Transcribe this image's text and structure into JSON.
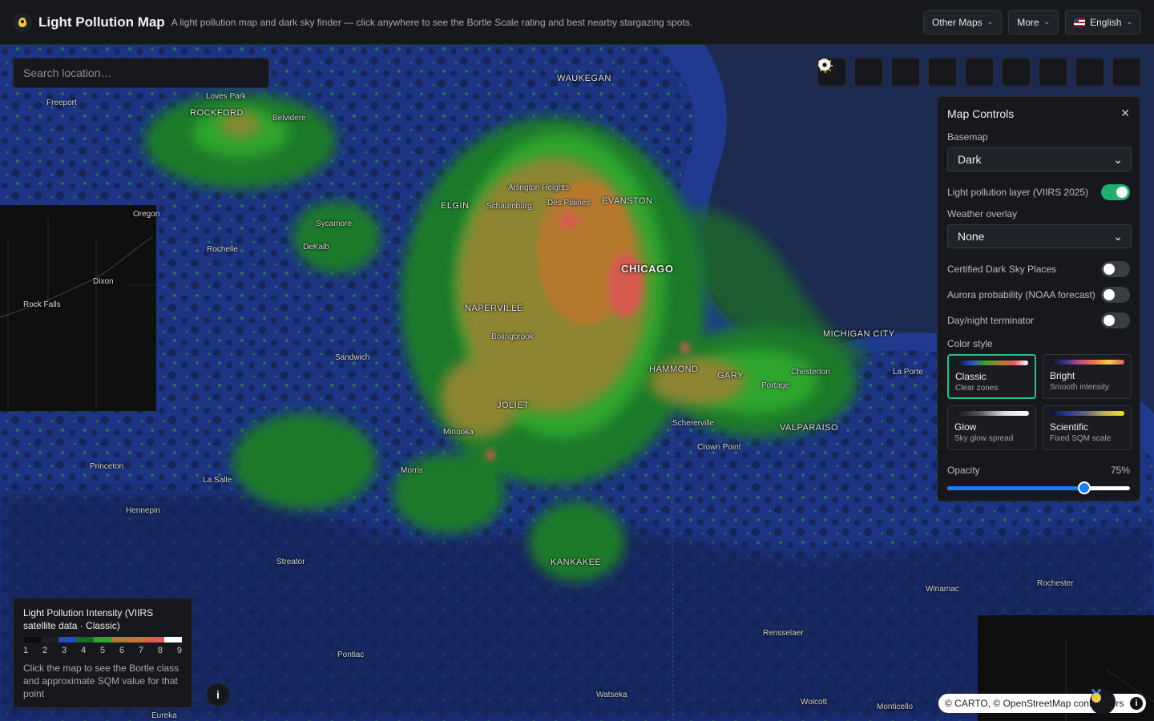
{
  "header": {
    "title": "Light Pollution Map",
    "subtitle": "A light pollution map and dark sky finder — click anywhere to see the Bortle Scale rating and best nearby stargazing spots.",
    "other_maps": "Other Maps",
    "more": "More",
    "language": "English"
  },
  "search": {
    "placeholder": "Search location…"
  },
  "toolbar": {
    "icons": [
      "star-icon",
      "waves-icon",
      "contrast-icon",
      "telescope-icon",
      "moon-icon",
      "sun-icon",
      "clock-icon",
      "camera-icon",
      "gear-icon"
    ]
  },
  "panel": {
    "title": "Map Controls",
    "close": "✕",
    "basemap_label": "Basemap",
    "basemap_value": "Dark",
    "light_layer_label": "Light pollution layer (VIIRS 2025)",
    "light_layer_on": true,
    "weather_label": "Weather overlay",
    "weather_value": "None",
    "dark_sky_label": "Certified Dark Sky Places",
    "aurora_label": "Aurora probability (NOAA forecast)",
    "terminator_label": "Day/night terminator",
    "color_style_label": "Color style",
    "styles": [
      {
        "name": "Classic",
        "desc": "Clear zones"
      },
      {
        "name": "Bright",
        "desc": "Smooth intensity"
      },
      {
        "name": "Glow",
        "desc": "Sky glow spread"
      },
      {
        "name": "Scientific",
        "desc": "Fixed SQM scale"
      }
    ],
    "opacity_label": "Opacity",
    "opacity_value": "75%",
    "opacity_fraction": 0.75
  },
  "legend": {
    "title": "Light Pollution Intensity (VIIRS satellite data · Classic)",
    "numbers": [
      "1",
      "2",
      "3",
      "4",
      "5",
      "6",
      "7",
      "8",
      "9"
    ],
    "colors": [
      "#0b0b0b",
      "#1c1f2a",
      "#2a47c9",
      "#1a6b2a",
      "#2fa52f",
      "#a5832a",
      "#d0712f",
      "#e8555c",
      "#ffffff"
    ],
    "hint": "Click the map to see the Bortle class and approximate SQM value for that point"
  },
  "info_button": "i",
  "attribution": "© CARTO, © OpenStreetMap contributors",
  "places": [
    {
      "name": "WAUKEGAN",
      "cls": "big"
    },
    {
      "name": "Loves Park",
      "cls": ""
    },
    {
      "name": "ROCKFORD",
      "cls": "big"
    },
    {
      "name": "Belvidere",
      "cls": ""
    },
    {
      "name": "Freeport",
      "cls": ""
    },
    {
      "name": "Oregon",
      "cls": ""
    },
    {
      "name": "Arlington Heights",
      "cls": ""
    },
    {
      "name": "ELGIN",
      "cls": "big"
    },
    {
      "name": "Schaumburg",
      "cls": ""
    },
    {
      "name": "Des Plaines",
      "cls": ""
    },
    {
      "name": "EVANSTON",
      "cls": "big"
    },
    {
      "name": "Sycamore",
      "cls": ""
    },
    {
      "name": "Rochelle",
      "cls": ""
    },
    {
      "name": "DeKalb",
      "cls": ""
    },
    {
      "name": "CHICAGO",
      "cls": "city"
    },
    {
      "name": "Dixon",
      "cls": ""
    },
    {
      "name": "Rock Falls",
      "cls": ""
    },
    {
      "name": "NAPERVILLE",
      "cls": "big"
    },
    {
      "name": "Bolingbrook",
      "cls": ""
    },
    {
      "name": "MICHIGAN CITY",
      "cls": "big"
    },
    {
      "name": "Sandwich",
      "cls": ""
    },
    {
      "name": "HAMMOND",
      "cls": "big"
    },
    {
      "name": "GARY",
      "cls": "big"
    },
    {
      "name": "Chesterton",
      "cls": ""
    },
    {
      "name": "La Porte",
      "cls": ""
    },
    {
      "name": "Portage",
      "cls": ""
    },
    {
      "name": "JOLIET",
      "cls": "big"
    },
    {
      "name": "Schererville",
      "cls": ""
    },
    {
      "name": "VALPARAISO",
      "cls": "big"
    },
    {
      "name": "Minooka",
      "cls": ""
    },
    {
      "name": "Crown Point",
      "cls": ""
    },
    {
      "name": "Princeton",
      "cls": ""
    },
    {
      "name": "Morris",
      "cls": ""
    },
    {
      "name": "La Salle",
      "cls": ""
    },
    {
      "name": "Hennepin",
      "cls": ""
    },
    {
      "name": "KANKAKEE",
      "cls": "big"
    },
    {
      "name": "Streator",
      "cls": ""
    },
    {
      "name": "Winamac",
      "cls": ""
    },
    {
      "name": "Rochester",
      "cls": ""
    },
    {
      "name": "Rensselaer",
      "cls": ""
    },
    {
      "name": "Pontiac",
      "cls": ""
    },
    {
      "name": "Watseka",
      "cls": ""
    },
    {
      "name": "Wolcott",
      "cls": ""
    },
    {
      "name": "Monticello",
      "cls": ""
    },
    {
      "name": "Eureka",
      "cls": ""
    }
  ]
}
